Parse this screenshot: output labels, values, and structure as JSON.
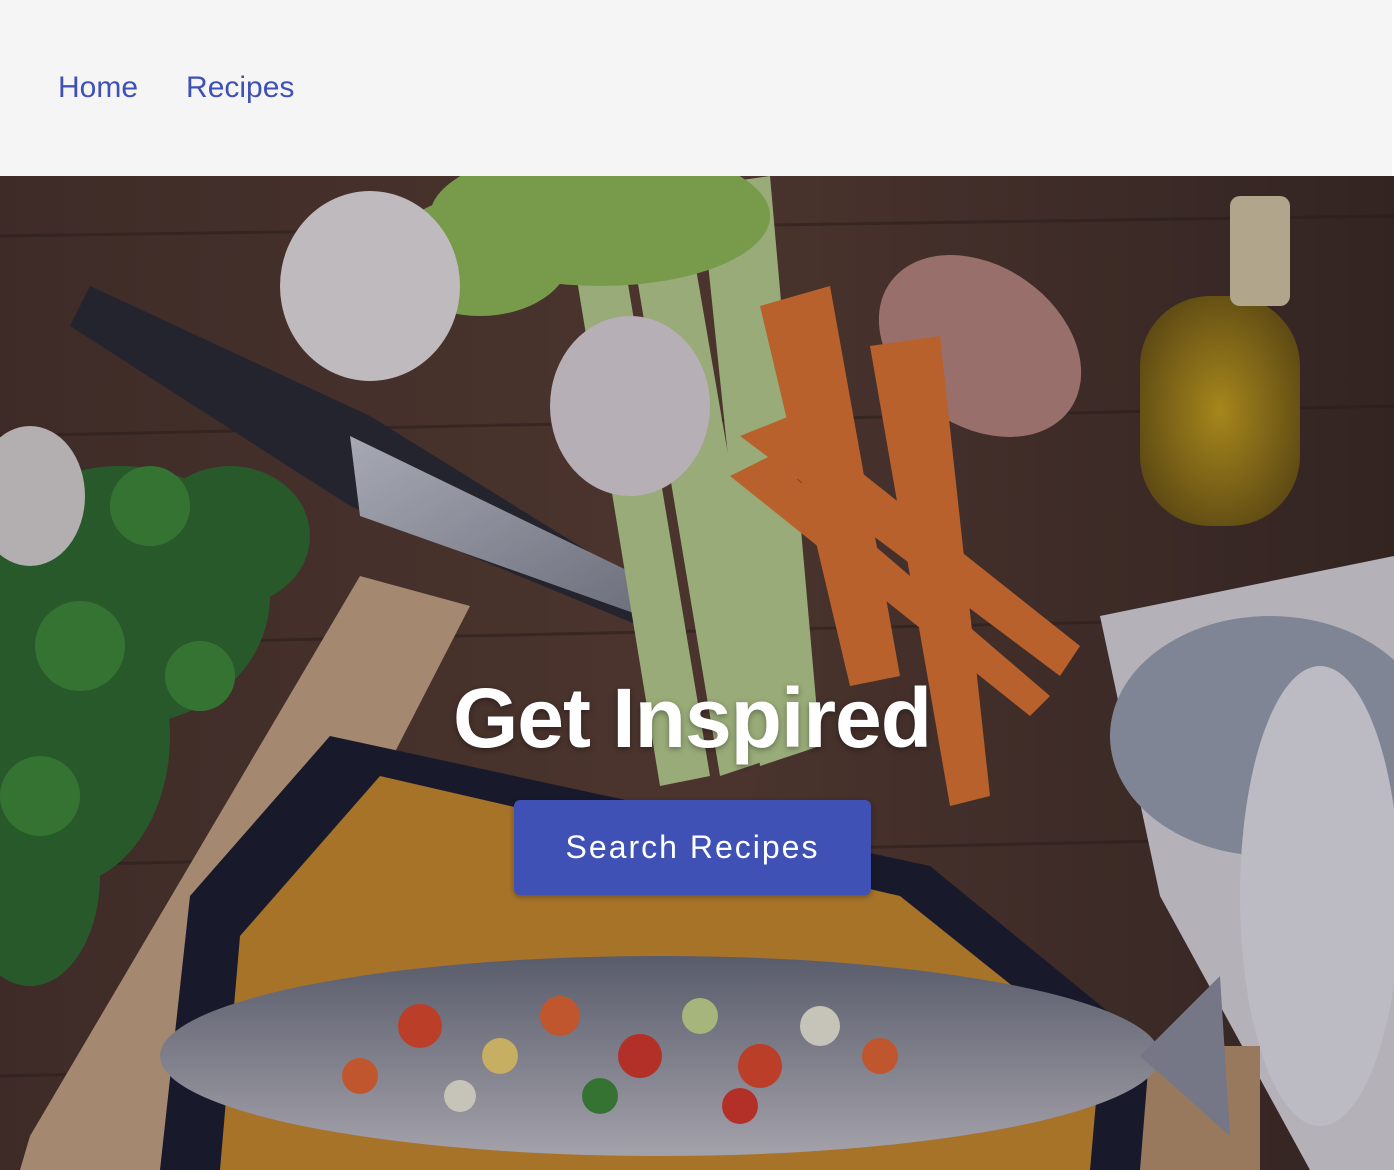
{
  "nav": {
    "items": [
      {
        "label": "Home"
      },
      {
        "label": "Recipes"
      }
    ]
  },
  "hero": {
    "title": "Get Inspired",
    "button_label": "Search Recipes",
    "image_description_icon": "food-photo"
  },
  "colors": {
    "accent": "#3f51b5",
    "navbar_bg": "#f5f5f5",
    "hero_text": "#ffffff"
  }
}
